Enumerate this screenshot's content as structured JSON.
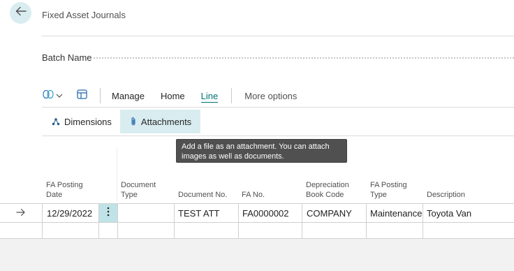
{
  "page": {
    "title": "Fixed Asset Journals"
  },
  "batch": {
    "label": "Batch Name",
    "value": ""
  },
  "toolbar": {
    "items": [
      "Manage",
      "Home",
      "Line"
    ],
    "active": "Line",
    "more_label": "More options"
  },
  "actions": {
    "dimensions_label": "Dimensions",
    "attachments_label": "Attachments"
  },
  "tooltip": {
    "text": "Add a file as an attachment. You can attach images as well as documents."
  },
  "columns": {
    "fa_posting_date": [
      "FA Posting",
      "Date"
    ],
    "document_type": [
      "Document",
      "Type"
    ],
    "document_no": [
      "Document No."
    ],
    "fa_no": [
      "FA No."
    ],
    "depreciation_book_code": [
      "Depreciation",
      "Book Code"
    ],
    "fa_posting_type": [
      "FA Posting",
      "Type"
    ],
    "description": [
      "Description"
    ]
  },
  "rows": [
    {
      "fa_posting_date": "12/29/2022",
      "document_type": "",
      "document_no": "TEST ATT",
      "fa_no": "FA0000002",
      "depreciation_book_code": "COMPANY",
      "fa_posting_type": "Maintenance",
      "description": "Toyota Van"
    }
  ],
  "colors": {
    "accent": "#00727a",
    "hover_bg": "#d9edf0",
    "tooltip_bg": "#505050"
  },
  "icons": {
    "back": "arrow-left-icon",
    "copilot": "copilot-icon",
    "layout": "layout-icon",
    "dimensions": "dimensions-icon",
    "attachments": "paperclip-icon",
    "row_indicator": "arrow-right-icon",
    "row_menu": "more-vertical-icon"
  }
}
